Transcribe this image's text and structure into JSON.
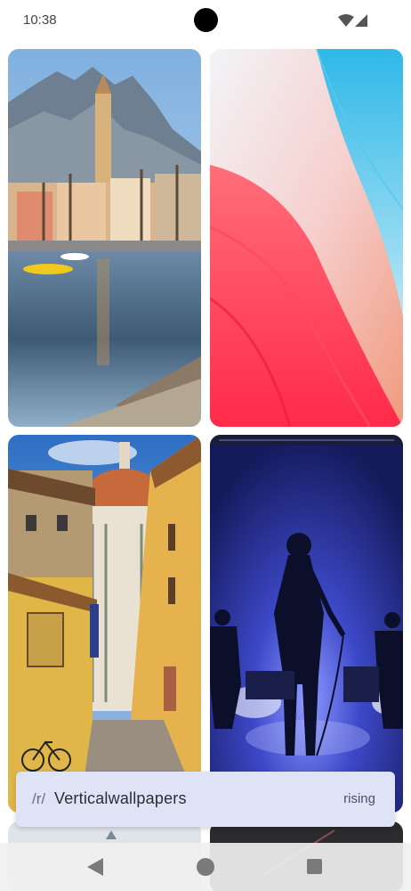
{
  "status_bar": {
    "time": "10:38",
    "icons": [
      "wifi-icon",
      "cellular-signal-icon"
    ]
  },
  "wallpapers": [
    {
      "subject": "lakeside town with bell tower and mountains"
    },
    {
      "subject": "abstract red and blue gradient curves"
    },
    {
      "subject": "Florence street with cathedral dome"
    },
    {
      "subject": "silhouette of singer on concert stage"
    },
    {
      "subject": "snowy scene (partially visible)"
    },
    {
      "subject": "dark image with light streaks (partially visible)"
    }
  ],
  "subreddit_bar": {
    "prefix": "/r/",
    "name": "Verticalwallpapers",
    "sort_label": "rising"
  },
  "nav_bar": {
    "icons": [
      "back-icon",
      "home-icon",
      "recents-icon"
    ]
  },
  "colors": {
    "accent_bar": "#dfe3f6",
    "background": "#ffffff"
  }
}
